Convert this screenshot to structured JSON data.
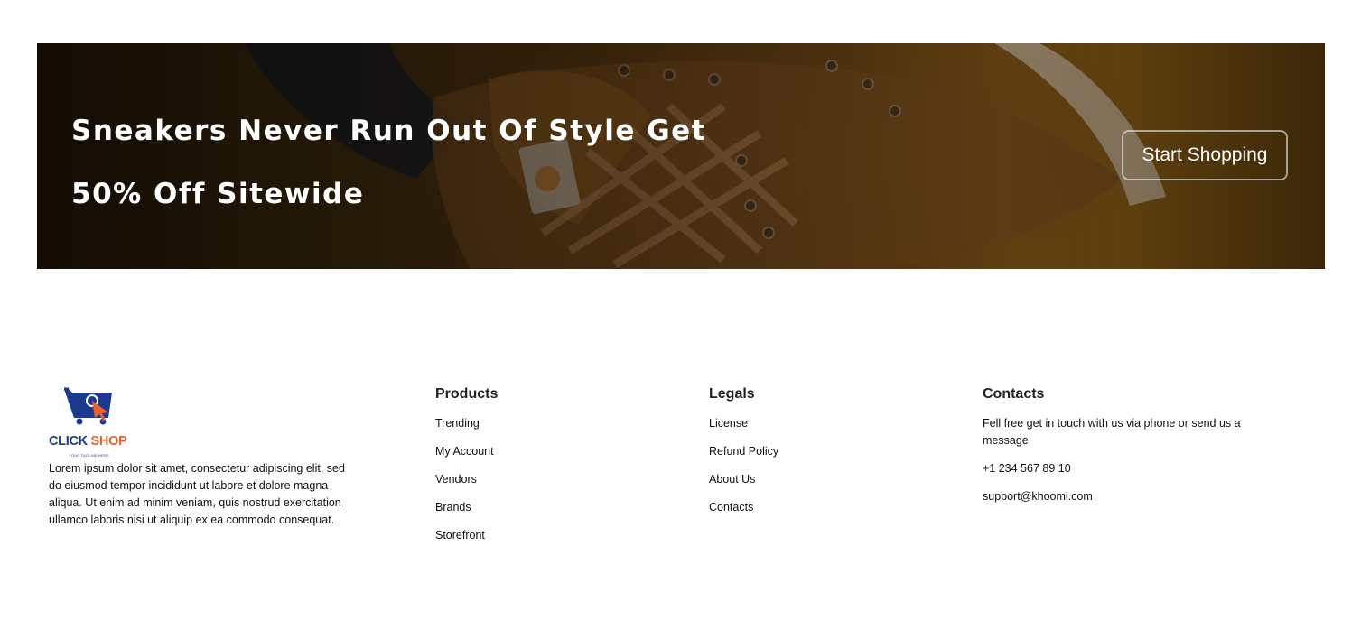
{
  "banner": {
    "title_line1": "Sneakers Never Run Out Of Style Get",
    "title_line2": "50% Off Sitewide",
    "cta_label": "Start Shopping"
  },
  "logo": {
    "brand_part1": "CLICK",
    "brand_part2": "SHOP",
    "tagline": "YOUR TAGLINE HERE",
    "colors": {
      "primary": "#1b3a8f",
      "accent": "#e8622a"
    }
  },
  "about": {
    "text": "Lorem ipsum dolor sit amet, consectetur adipiscing elit, sed do eiusmod tempor incididunt ut labore et dolore magna aliqua. Ut enim ad minim veniam, quis nostrud exercitation ullamco laboris nisi ut aliquip ex ea commodo consequat."
  },
  "products": {
    "heading": "Products",
    "items": [
      "Trending",
      "My Account",
      "Vendors",
      "Brands",
      "Storefront"
    ]
  },
  "legals": {
    "heading": "Legals",
    "items": [
      "License",
      "Refund Policy",
      "About Us",
      "Contacts"
    ]
  },
  "contacts": {
    "heading": "Contacts",
    "message": "Fell free get in touch with us via phone or send us a message",
    "phone": "+1 234 567 89 10",
    "email": "support@khoomi.com"
  }
}
